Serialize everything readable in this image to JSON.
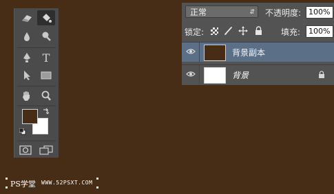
{
  "toolbox": {
    "tools": [
      {
        "row": 1,
        "icon": "eraser-icon",
        "active": false
      },
      {
        "row": 1,
        "icon": "paint-bucket-icon",
        "active": true
      },
      {
        "row": 2,
        "icon": "blur-drop-icon",
        "active": false
      },
      {
        "row": 2,
        "icon": "dodge-icon",
        "active": false
      },
      {
        "row": 3,
        "icon": "pen-icon",
        "active": false
      },
      {
        "row": 3,
        "icon": "type-icon",
        "active": false
      },
      {
        "row": 4,
        "icon": "path-selection-icon",
        "active": false
      },
      {
        "row": 4,
        "icon": "rectangle-icon",
        "active": false
      },
      {
        "row": 5,
        "icon": "hand-icon",
        "active": false
      },
      {
        "row": 5,
        "icon": "zoom-icon",
        "active": false
      }
    ],
    "type_glyph": "T",
    "foreground_color": "#472c16",
    "background_color": "#ffffff",
    "bottom_icons": [
      "quick-mask-icon",
      "screen-mode-icon"
    ]
  },
  "layers_panel": {
    "blend_mode": "正常",
    "opacity_label": "不透明度:",
    "opacity_value": "100%",
    "lock_label": "锁定:",
    "fill_label": "填充:",
    "fill_value": "100%",
    "lock_icons": [
      "lock-transparency-icon",
      "lock-paint-icon",
      "lock-position-icon",
      "lock-all-icon"
    ],
    "layers": [
      {
        "name": "背景副本",
        "thumb_color": "#472c16",
        "selected": true,
        "italic": false,
        "locked": false
      },
      {
        "name": "背景",
        "thumb_color": "#ffffff",
        "selected": false,
        "italic": true,
        "locked": true
      }
    ]
  },
  "watermark": {
    "brand": "PS学堂",
    "url": "WWW.52PSXT.COM"
  },
  "colors": {
    "canvas": "#472c16",
    "panel": "#535353",
    "selected_row": "#5b6f86"
  }
}
